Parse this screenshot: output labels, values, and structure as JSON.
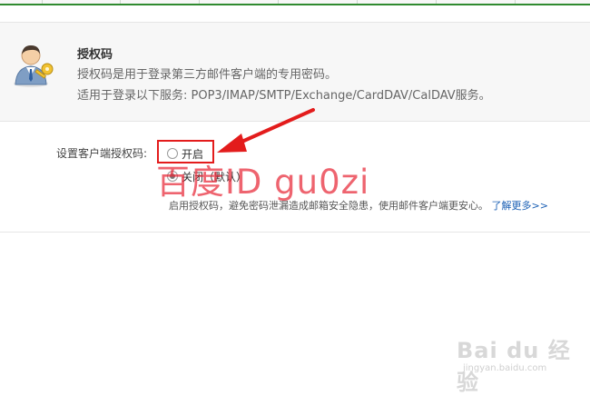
{
  "header": {
    "title": "授权码",
    "description_line1": "授权码是用于登录第三方邮件客户端的专用密码。",
    "description_line2": "适用于登录以下服务: POP3/IMAP/SMTP/Exchange/CardDAV/CalDAV服务。"
  },
  "setting": {
    "label": "设置客户端授权码:",
    "options": [
      {
        "label": "开启",
        "selected": false
      },
      {
        "label": "关闭（默认）",
        "selected": true
      }
    ]
  },
  "tip": {
    "text": "启用授权码，避免密码泄漏造成邮箱安全隐患，使用邮件客户端更安心。",
    "link_label": "了解更多>>"
  },
  "watermark": {
    "overlay_text": "百度ID gu0zi",
    "logo_text": "Bai du 经验",
    "url": "jingyan.baidu.com"
  },
  "colors": {
    "annotation_red": "#e31c1c",
    "link_blue": "#1a5fb4",
    "tab_green": "#2f8a2f"
  },
  "icons": {
    "avatar": "user-key-icon",
    "annotation_arrow": "arrow-icon"
  }
}
